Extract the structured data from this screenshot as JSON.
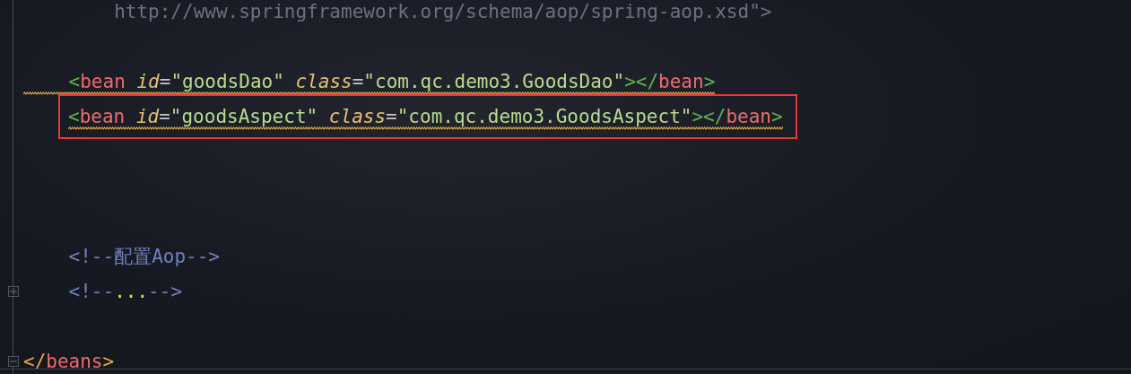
{
  "editor": {
    "lines": [
      {
        "kind": "code",
        "tokens": [
          {
            "kind": "url",
            "text": "        http://www.springframework.org/schema/aop/spring-aop.xsd\">"
          }
        ]
      },
      {
        "kind": "blank"
      },
      {
        "kind": "code",
        "warning": true,
        "highlighted": false,
        "tokens": [
          {
            "kind": "bracket",
            "text": "    <"
          },
          {
            "kind": "tag",
            "text": "bean"
          },
          {
            "kind": "attr",
            "text": " id"
          },
          {
            "kind": "equals",
            "text": "="
          },
          {
            "kind": "string",
            "text": "\"goodsDao\""
          },
          {
            "kind": "attr",
            "text": " class"
          },
          {
            "kind": "equals",
            "text": "="
          },
          {
            "kind": "string",
            "text": "\"com.qc.demo3.GoodsDao\""
          },
          {
            "kind": "bracket",
            "text": "></"
          },
          {
            "kind": "tag",
            "text": "bean"
          },
          {
            "kind": "bracket",
            "text": ">"
          }
        ]
      },
      {
        "kind": "code",
        "warning": true,
        "highlighted": true,
        "tokens": [
          {
            "kind": "bracket",
            "text": "<"
          },
          {
            "kind": "tag",
            "text": "bean"
          },
          {
            "kind": "attr",
            "text": " id"
          },
          {
            "kind": "equals",
            "text": "="
          },
          {
            "kind": "string",
            "text": "\"goodsAspect\""
          },
          {
            "kind": "attr",
            "text": " class"
          },
          {
            "kind": "equals",
            "text": "="
          },
          {
            "kind": "string",
            "text": "\"com.qc.demo3.GoodsAspect\""
          },
          {
            "kind": "bracket",
            "text": "></"
          },
          {
            "kind": "tag",
            "text": "bean"
          },
          {
            "kind": "bracket",
            "text": ">"
          }
        ]
      },
      {
        "kind": "blank"
      },
      {
        "kind": "blank"
      },
      {
        "kind": "blank"
      },
      {
        "kind": "code",
        "tokens": [
          {
            "kind": "comment",
            "text": "    <!--配置Aop-->"
          }
        ]
      },
      {
        "kind": "code",
        "folded": true,
        "tokens": [
          {
            "kind": "comment",
            "text": "    <!--"
          },
          {
            "kind": "ellipsis",
            "text": "..."
          },
          {
            "kind": "comment",
            "text": "-->"
          }
        ]
      },
      {
        "kind": "blank"
      },
      {
        "kind": "code",
        "folded": false,
        "tokens": [
          {
            "kind": "rootbracket",
            "text": "</"
          },
          {
            "kind": "tag",
            "text": "beans"
          },
          {
            "kind": "rootbracket",
            "text": ">"
          }
        ]
      }
    ]
  }
}
